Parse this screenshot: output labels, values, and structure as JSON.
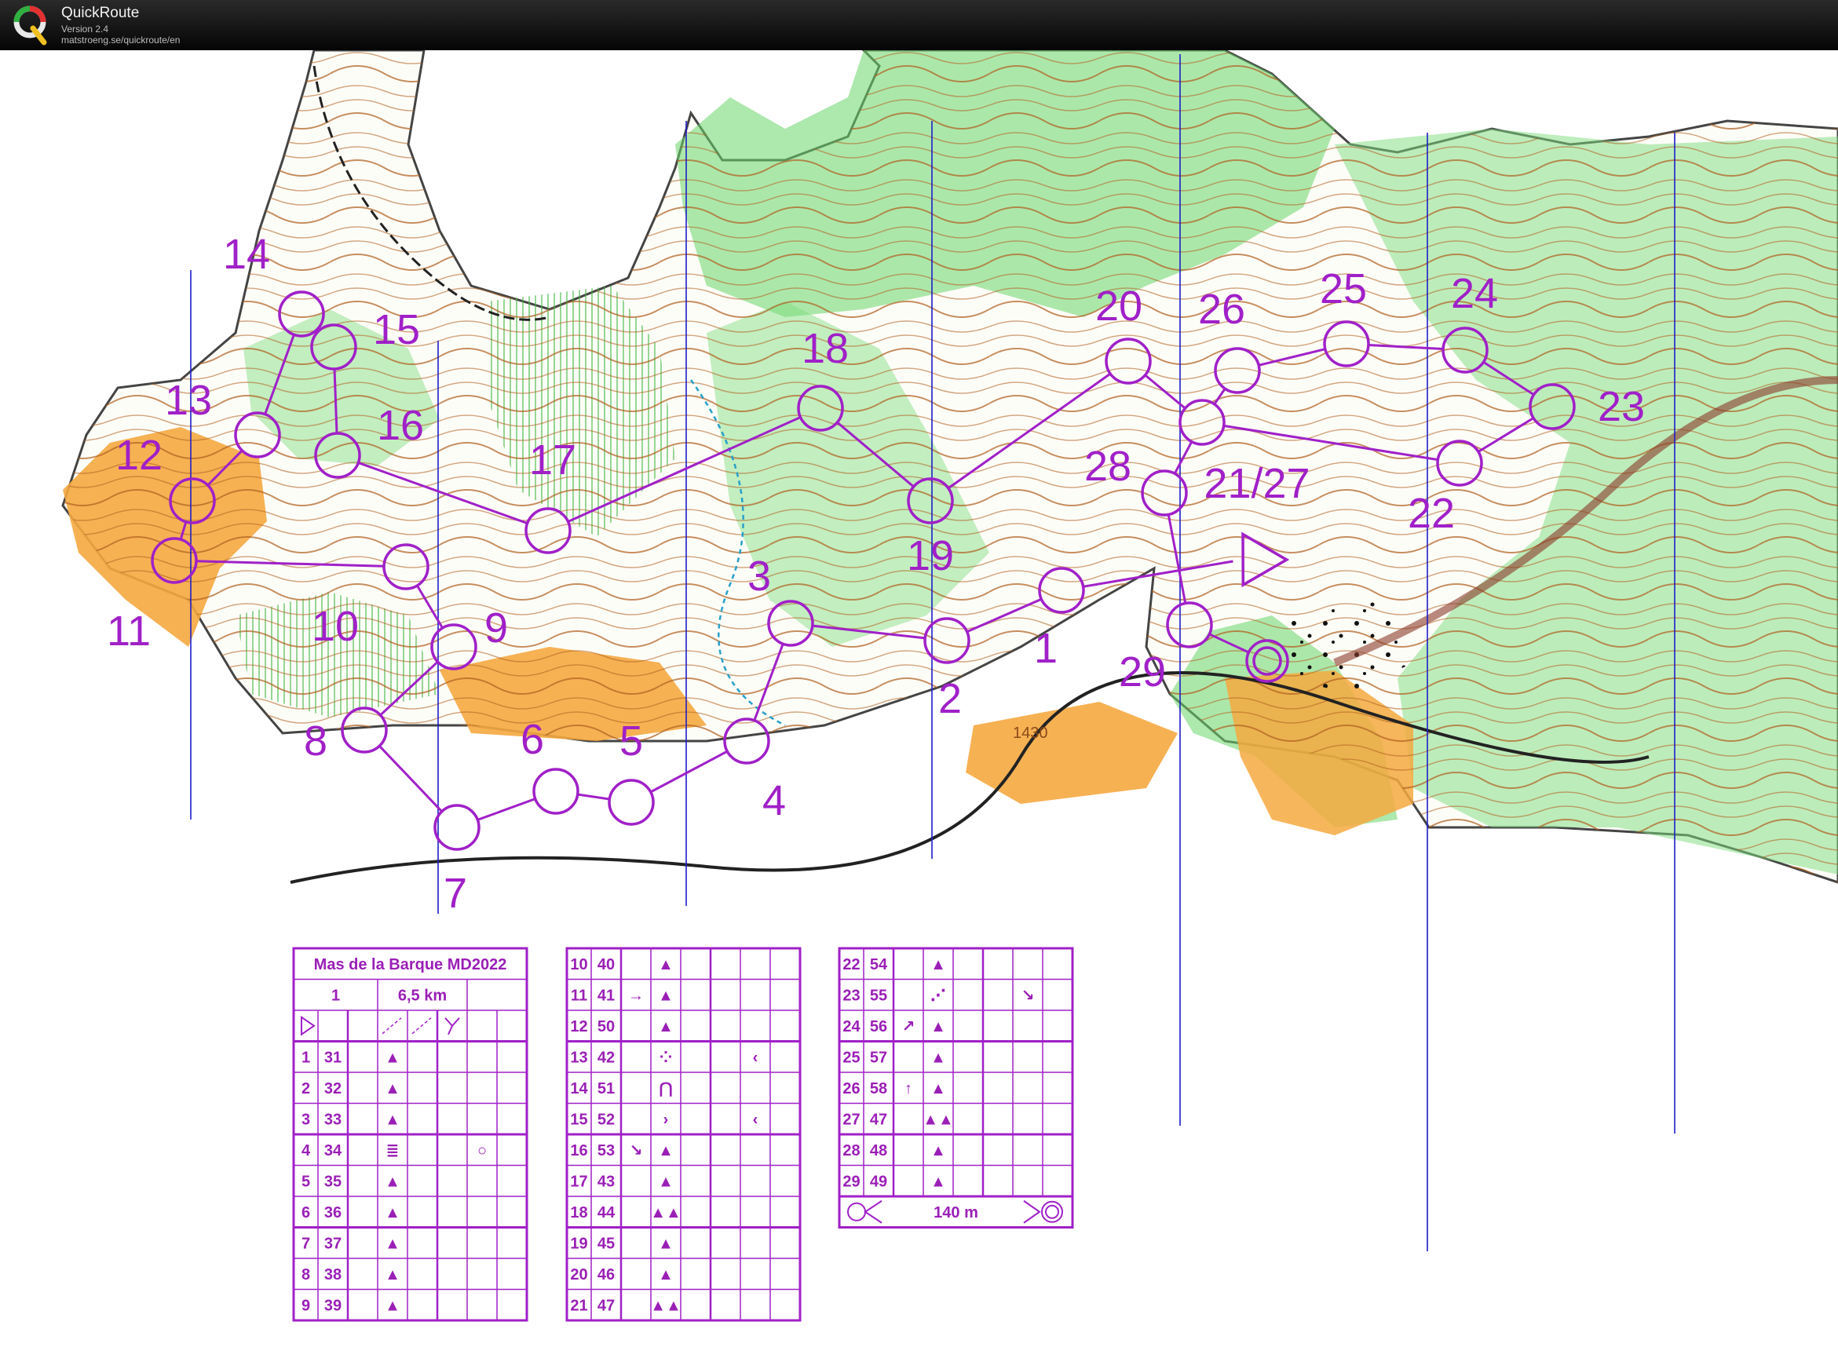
{
  "window": {
    "app_name": "QuickRoute",
    "version": "Version 2.4",
    "url": "matstroeng.se/quickroute/en"
  },
  "colors": {
    "course": "#a020c8",
    "open_land": "#f5a940",
    "forest": "#5ad25a",
    "contour": "#b0601e",
    "water": "#28a0c8",
    "magnetic_north": "#1e1ec8"
  },
  "map": {
    "contour_label": "1430",
    "controls": [
      {
        "label": "1"
      },
      {
        "label": "2"
      },
      {
        "label": "3"
      },
      {
        "label": "4"
      },
      {
        "label": "5"
      },
      {
        "label": "6"
      },
      {
        "label": "7"
      },
      {
        "label": "8"
      },
      {
        "label": "9"
      },
      {
        "label": "10"
      },
      {
        "label": "11"
      },
      {
        "label": "12"
      },
      {
        "label": "13"
      },
      {
        "label": "14"
      },
      {
        "label": "15"
      },
      {
        "label": "16"
      },
      {
        "label": "17"
      },
      {
        "label": "18"
      },
      {
        "label": "19"
      },
      {
        "label": "20"
      },
      {
        "label": "21/27"
      },
      {
        "label": "22"
      },
      {
        "label": "23"
      },
      {
        "label": "24"
      },
      {
        "label": "25"
      },
      {
        "label": "26"
      },
      {
        "label": "28"
      },
      {
        "label": "29"
      }
    ]
  },
  "control_descriptions": {
    "event_title": "Mas de la Barque MD2022",
    "course": "1",
    "length": "6,5 km",
    "finish_distance": "140 m",
    "rows": [
      {
        "n": "1",
        "code": "31",
        "feature": "▲"
      },
      {
        "n": "2",
        "code": "32",
        "feature": "▲"
      },
      {
        "n": "3",
        "code": "33",
        "feature": "▲"
      },
      {
        "n": "4",
        "code": "34",
        "feature": "≣",
        "extra": "○"
      },
      {
        "n": "5",
        "code": "35",
        "feature": "▲"
      },
      {
        "n": "6",
        "code": "36",
        "feature": "▲"
      },
      {
        "n": "7",
        "code": "37",
        "feature": "▲"
      },
      {
        "n": "8",
        "code": "38",
        "feature": "▲"
      },
      {
        "n": "9",
        "code": "39",
        "feature": "▲"
      },
      {
        "n": "10",
        "code": "40",
        "feature": "▲"
      },
      {
        "n": "11",
        "code": "41",
        "dir": "→",
        "feature": "▲"
      },
      {
        "n": "12",
        "code": "50",
        "feature": "▲"
      },
      {
        "n": "13",
        "code": "42",
        "feature": "⁘",
        "extra": "‹"
      },
      {
        "n": "14",
        "code": "51",
        "feature": "⋂"
      },
      {
        "n": "15",
        "code": "52",
        "feature": "›",
        "extra": "‹"
      },
      {
        "n": "16",
        "code": "53",
        "dir": "↘",
        "feature": "▲"
      },
      {
        "n": "17",
        "code": "43",
        "feature": "▲"
      },
      {
        "n": "18",
        "code": "44",
        "feature": "▲▲"
      },
      {
        "n": "19",
        "code": "45",
        "feature": "▲"
      },
      {
        "n": "20",
        "code": "46",
        "feature": "▲"
      },
      {
        "n": "21",
        "code": "47",
        "feature": "▲▲"
      },
      {
        "n": "22",
        "code": "54",
        "feature": "▲"
      },
      {
        "n": "23",
        "code": "55",
        "feature": "⋰",
        "extra": "↘"
      },
      {
        "n": "24",
        "code": "56",
        "dir": "↗",
        "feature": "▲"
      },
      {
        "n": "25",
        "code": "57",
        "feature": "▲"
      },
      {
        "n": "26",
        "code": "58",
        "dir": "↑",
        "feature": "▲"
      },
      {
        "n": "27",
        "code": "47",
        "feature": "▲▲"
      },
      {
        "n": "28",
        "code": "48",
        "feature": "▲"
      },
      {
        "n": "29",
        "code": "49",
        "feature": "▲"
      }
    ]
  }
}
